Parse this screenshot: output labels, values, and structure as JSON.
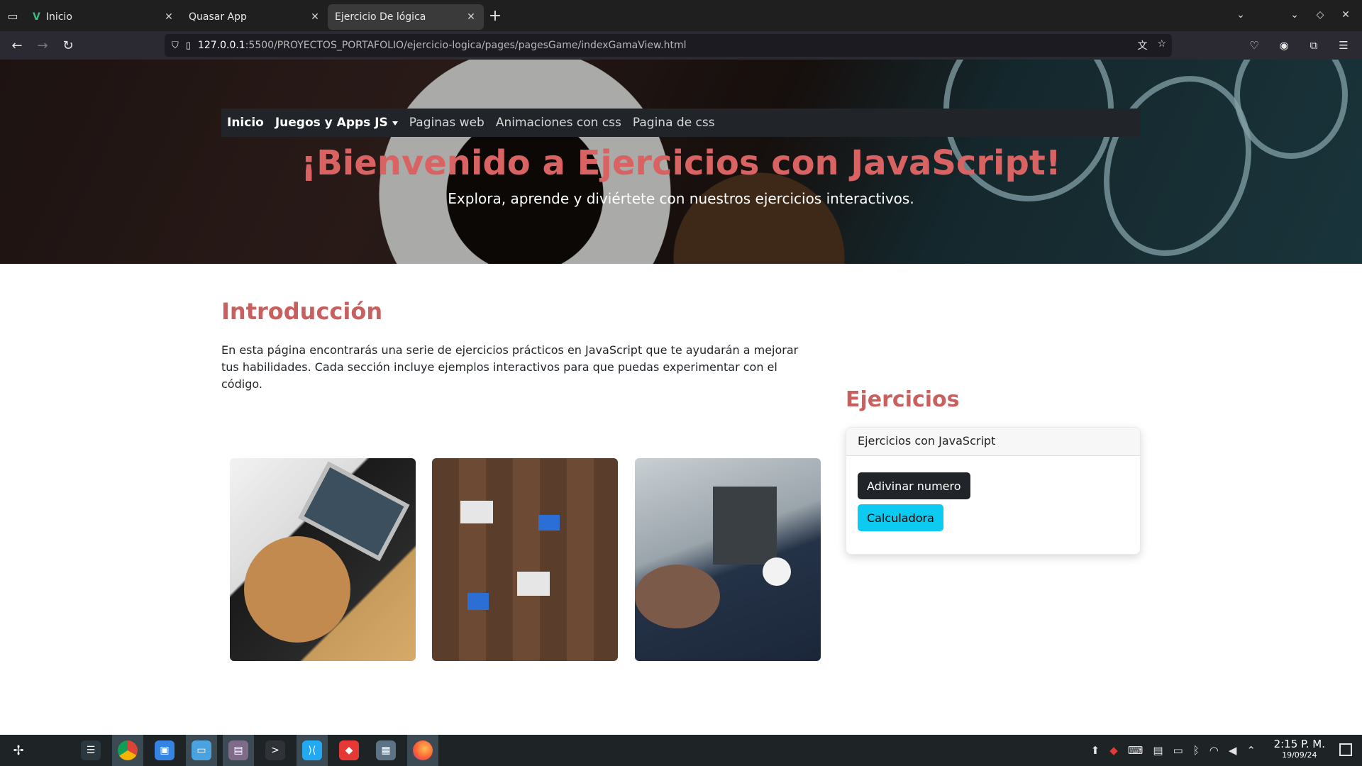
{
  "browser": {
    "tabs": [
      {
        "title": "Inicio",
        "favicon": "vue-icon",
        "active": false
      },
      {
        "title": "Quasar App",
        "favicon": "",
        "active": false
      },
      {
        "title": "Ejercicio De lógica",
        "favicon": "",
        "active": true
      }
    ],
    "new_tab_label": "+",
    "url": {
      "host": "127.0.0.1",
      "path": ":5500/PROYECTOS_PORTAFOLIO/ejercicio-logica/pages/pagesGame/indexGamaView.html"
    }
  },
  "site": {
    "nav": [
      {
        "label": "Inicio",
        "bold": true
      },
      {
        "label": "Juegos y Apps JS",
        "bold": true,
        "dropdown": true
      },
      {
        "label": "Paginas web",
        "bold": false
      },
      {
        "label": "Animaciones con css",
        "bold": false
      },
      {
        "label": "Pagina de css",
        "bold": false
      }
    ],
    "hero": {
      "title": "¡Bienvenido a Ejercicios con JavaScript!",
      "subtitle": "Explora, aprende y diviértete con nuestros ejercicios interactivos."
    },
    "intro": {
      "title": "Introducción",
      "text": "En esta página encontrarás una serie de ejercicios prácticos en JavaScript que te ayudarán a mejorar tus habilidades. Cada sección incluye ejemplos interactivos para que puedas experimentar con el código."
    },
    "exercises": {
      "title": "Ejercicios",
      "card_header": "Ejercicios con JavaScript",
      "buttons": [
        "Adivinar numero",
        "Calculadora"
      ]
    },
    "colors": {
      "accent": "#c96060",
      "hero_title": "#d96262",
      "navbar_bg": "#212529",
      "btn_dark": "#212529",
      "btn_info": "#0dcaf0"
    }
  },
  "taskbar": {
    "time": "2:15 P. M.",
    "date": "19/09/24"
  }
}
